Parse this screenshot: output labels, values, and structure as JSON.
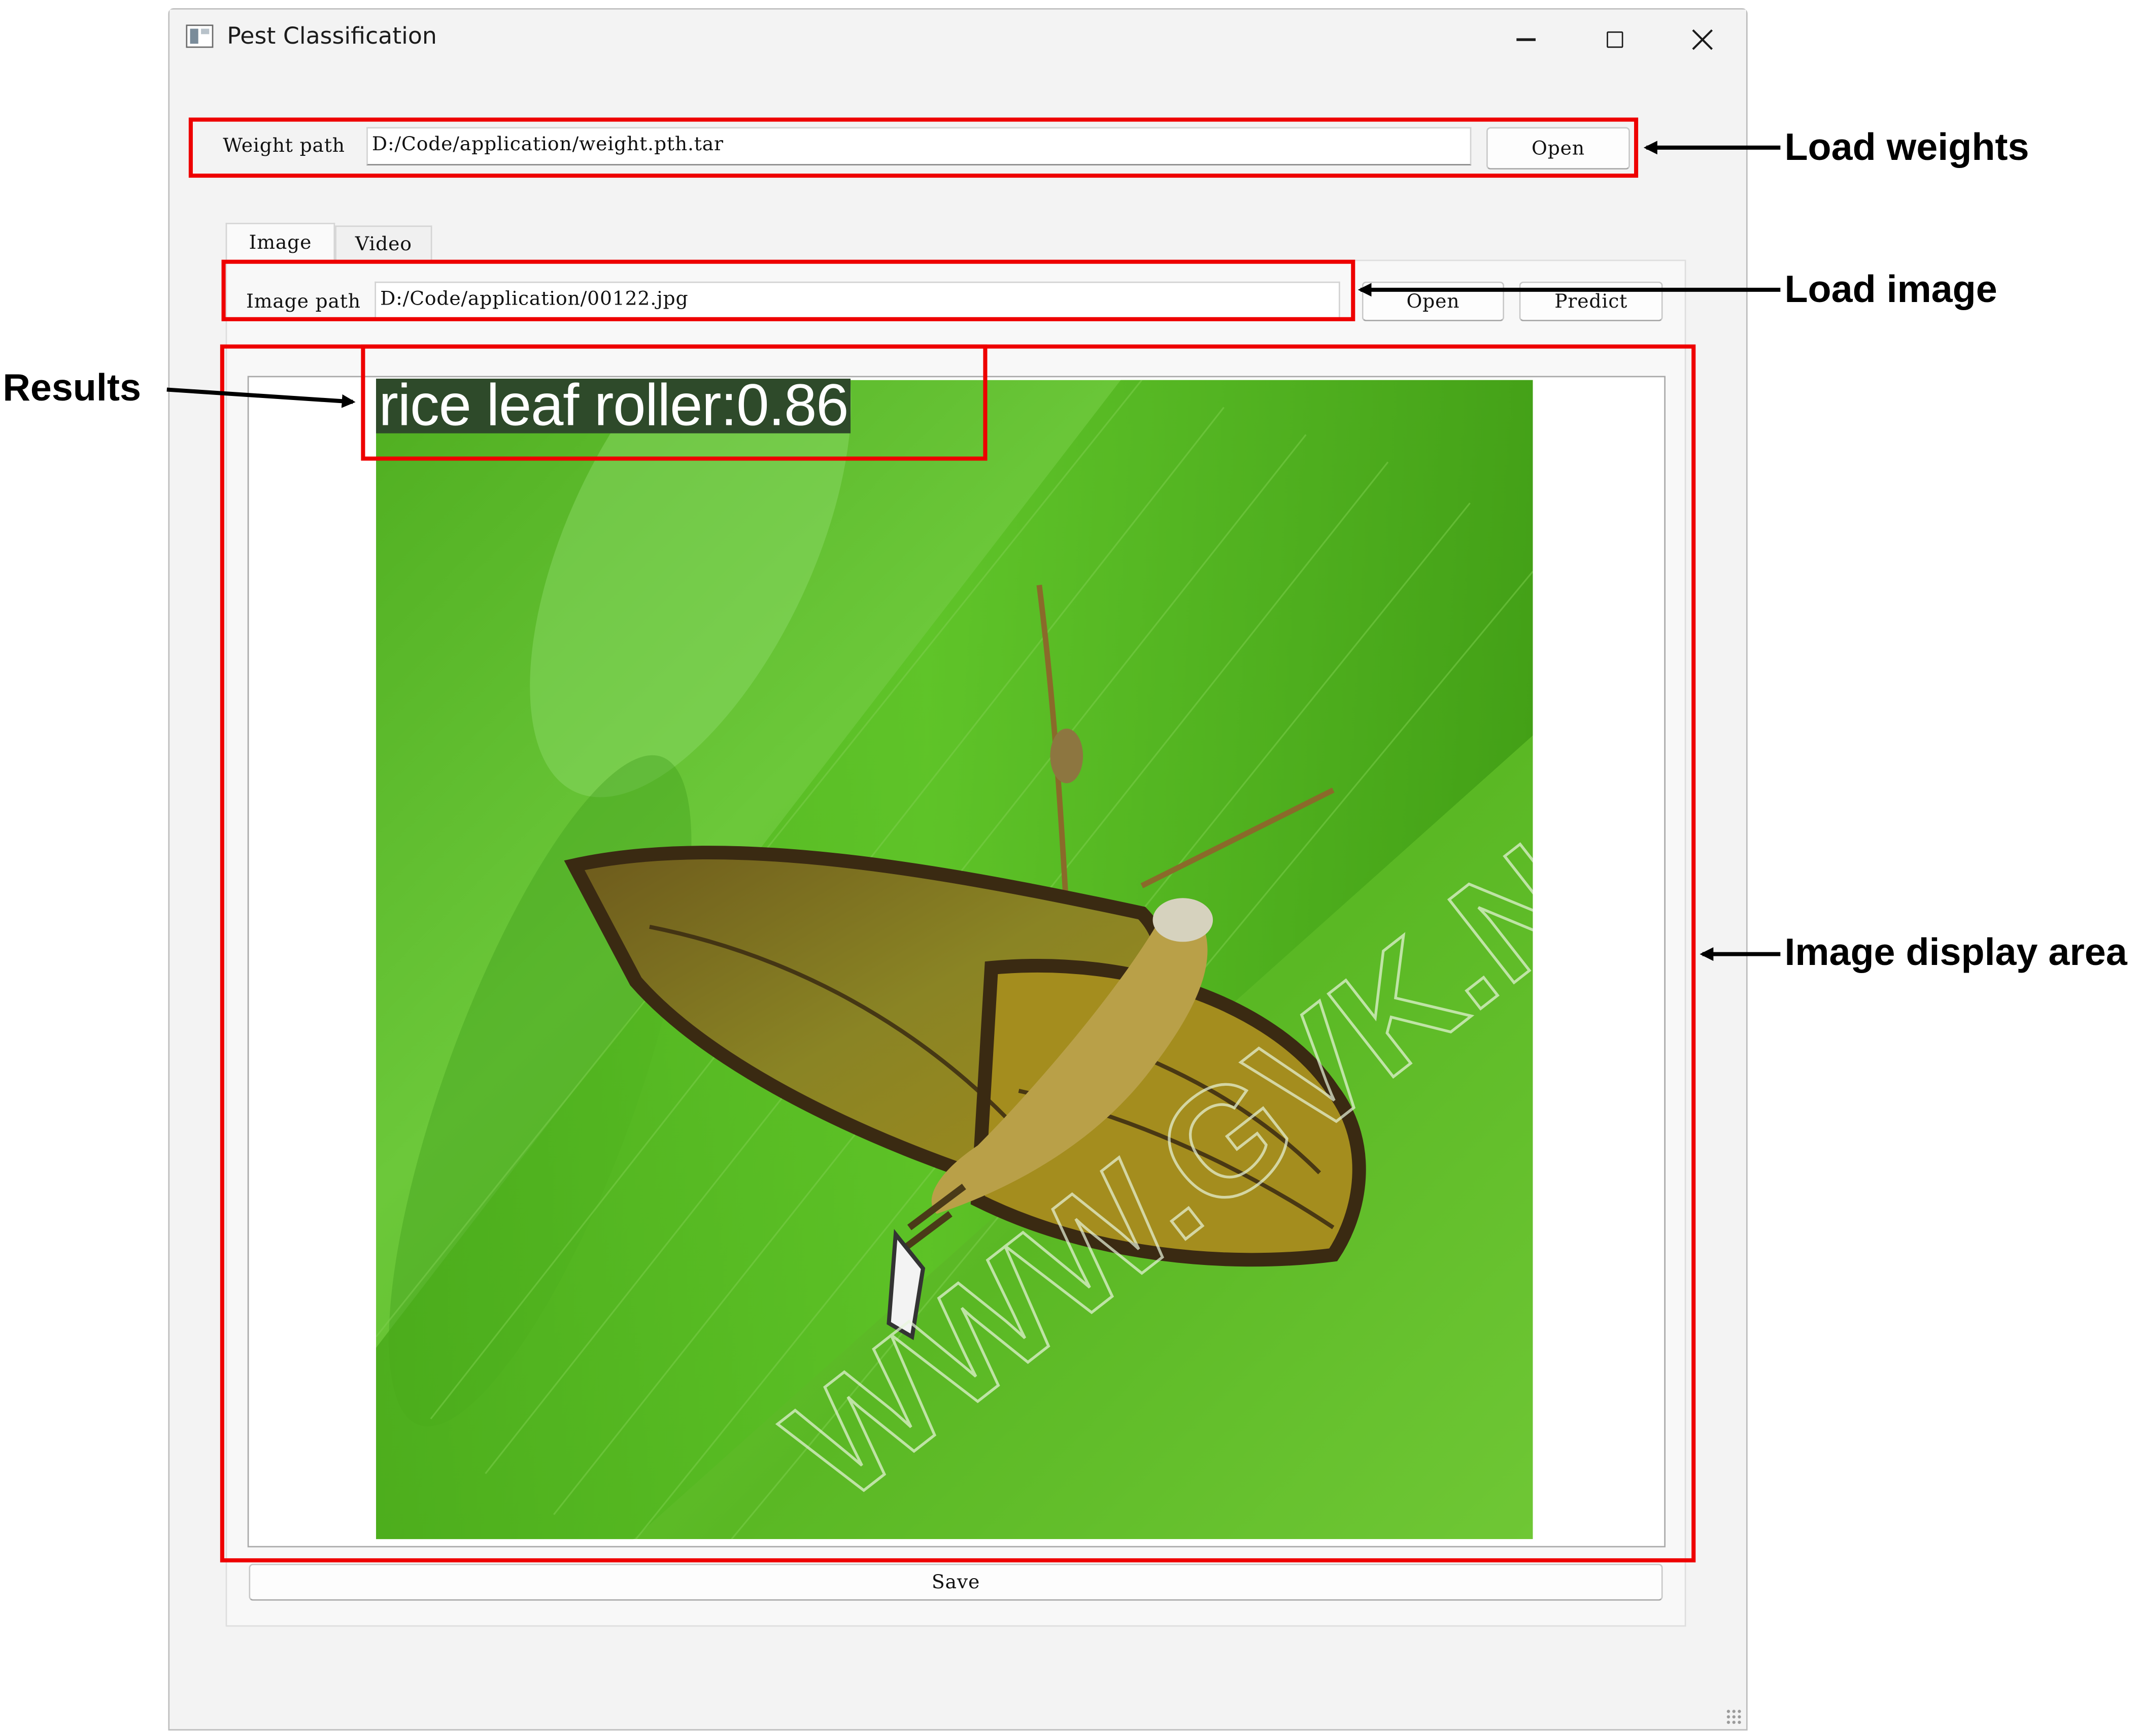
{
  "window": {
    "title": "Pest Classification",
    "icon": "app-window-icon",
    "controls": [
      "minimize-icon",
      "maximize-icon",
      "close-icon"
    ]
  },
  "weights": {
    "label": "Weight path",
    "value": "D:/Code/application/weight.pth.tar",
    "open_button": "Open"
  },
  "tabs": [
    {
      "label": "Image",
      "selected": true
    },
    {
      "label": "Video",
      "selected": false
    }
  ],
  "image_tab": {
    "label": "Image path",
    "value": "D:/Code/application/00122.jpg",
    "open_button": "Open",
    "predict_button": "Predict"
  },
  "result": {
    "text": "rice leaf roller:0.86",
    "watermark": "WWW.GVK.NET"
  },
  "save_button": "Save",
  "callouts": {
    "load_weights": "Load weights",
    "load_image": "Load image",
    "results": "Results",
    "image_display_area": "Image display area"
  },
  "colors": {
    "highlight": "#ee0000",
    "window_bg": "#f3f3f3",
    "result_bg": "#2e4a2a",
    "leaf_green": "#59c41f"
  }
}
